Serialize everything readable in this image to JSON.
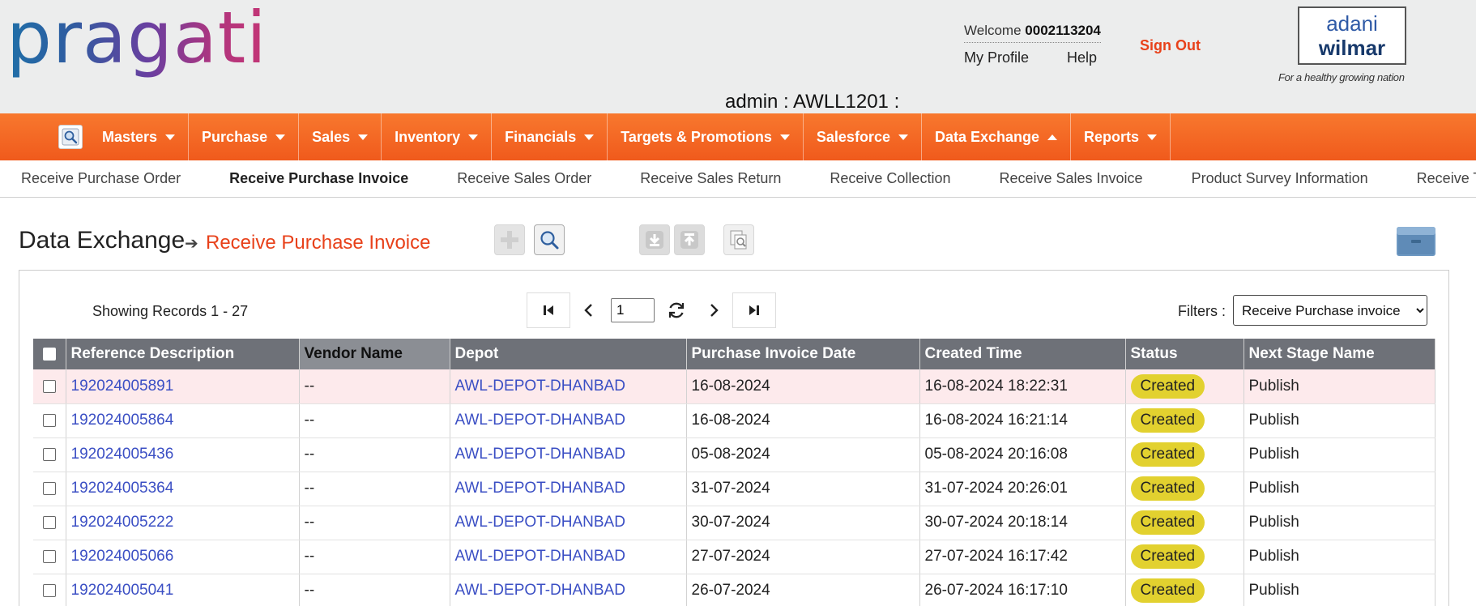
{
  "header": {
    "logo_text": "pragati",
    "welcome_label": "Welcome",
    "user_id": "0002113204",
    "my_profile": "My Profile",
    "help": "Help",
    "sign_out": "Sign Out",
    "brand_line1": "adani",
    "brand_line2": "wilmar",
    "tagline": "For a healthy growing nation",
    "admin_line": "admin : AWLL1201 :"
  },
  "nav": {
    "items": [
      {
        "label": "Masters",
        "caret": "down"
      },
      {
        "label": "Purchase",
        "caret": "down"
      },
      {
        "label": "Sales",
        "caret": "down"
      },
      {
        "label": "Inventory",
        "caret": "down"
      },
      {
        "label": "Financials",
        "caret": "down"
      },
      {
        "label": "Targets & Promotions",
        "caret": "down"
      },
      {
        "label": "Salesforce",
        "caret": "down"
      },
      {
        "label": "Data Exchange",
        "caret": "up"
      },
      {
        "label": "Reports",
        "caret": "down"
      }
    ],
    "accent_color": "#f26522"
  },
  "subnav": {
    "items": [
      {
        "label": "Receive Purchase Order"
      },
      {
        "label": "Receive Purchase Invoice",
        "active": true
      },
      {
        "label": "Receive Sales Order"
      },
      {
        "label": "Receive Sales Return"
      },
      {
        "label": "Receive Collection"
      },
      {
        "label": "Receive Sales Invoice"
      },
      {
        "label": "Product Survey Information"
      },
      {
        "label": "Receive Tertiary"
      }
    ]
  },
  "page": {
    "title": "Data Exchange",
    "subtitle": "Receive Purchase Invoice"
  },
  "grid": {
    "showing": "Showing Records 1 - 27",
    "page_value": "1",
    "filters_label": "Filters :",
    "filter_selected": "Receive Purchase invoice",
    "columns": [
      "Reference Description",
      "Vendor Name",
      "Depot",
      "Purchase Invoice Date",
      "Created Time",
      "Status",
      "Next Stage Name"
    ],
    "rows": [
      {
        "ref": "192024005891",
        "vendor": "--",
        "depot": "AWL-DEPOT-DHANBAD",
        "date": "16-08-2024",
        "created": "16-08-2024 18:22:31",
        "status": "Created",
        "next": "Publish"
      },
      {
        "ref": "192024005864",
        "vendor": "--",
        "depot": "AWL-DEPOT-DHANBAD",
        "date": "16-08-2024",
        "created": "16-08-2024 16:21:14",
        "status": "Created",
        "next": "Publish"
      },
      {
        "ref": "192024005436",
        "vendor": "--",
        "depot": "AWL-DEPOT-DHANBAD",
        "date": "05-08-2024",
        "created": "05-08-2024 20:16:08",
        "status": "Created",
        "next": "Publish"
      },
      {
        "ref": "192024005364",
        "vendor": "--",
        "depot": "AWL-DEPOT-DHANBAD",
        "date": "31-07-2024",
        "created": "31-07-2024 20:26:01",
        "status": "Created",
        "next": "Publish"
      },
      {
        "ref": "192024005222",
        "vendor": "--",
        "depot": "AWL-DEPOT-DHANBAD",
        "date": "30-07-2024",
        "created": "30-07-2024 20:18:14",
        "status": "Created",
        "next": "Publish"
      },
      {
        "ref": "192024005066",
        "vendor": "--",
        "depot": "AWL-DEPOT-DHANBAD",
        "date": "27-07-2024",
        "created": "27-07-2024 16:17:42",
        "status": "Created",
        "next": "Publish"
      },
      {
        "ref": "192024005041",
        "vendor": "--",
        "depot": "AWL-DEPOT-DHANBAD",
        "date": "26-07-2024",
        "created": "26-07-2024 16:17:10",
        "status": "Created",
        "next": "Publish"
      }
    ],
    "status_color": "#e2d12f",
    "link_color": "#3b4fc4"
  }
}
